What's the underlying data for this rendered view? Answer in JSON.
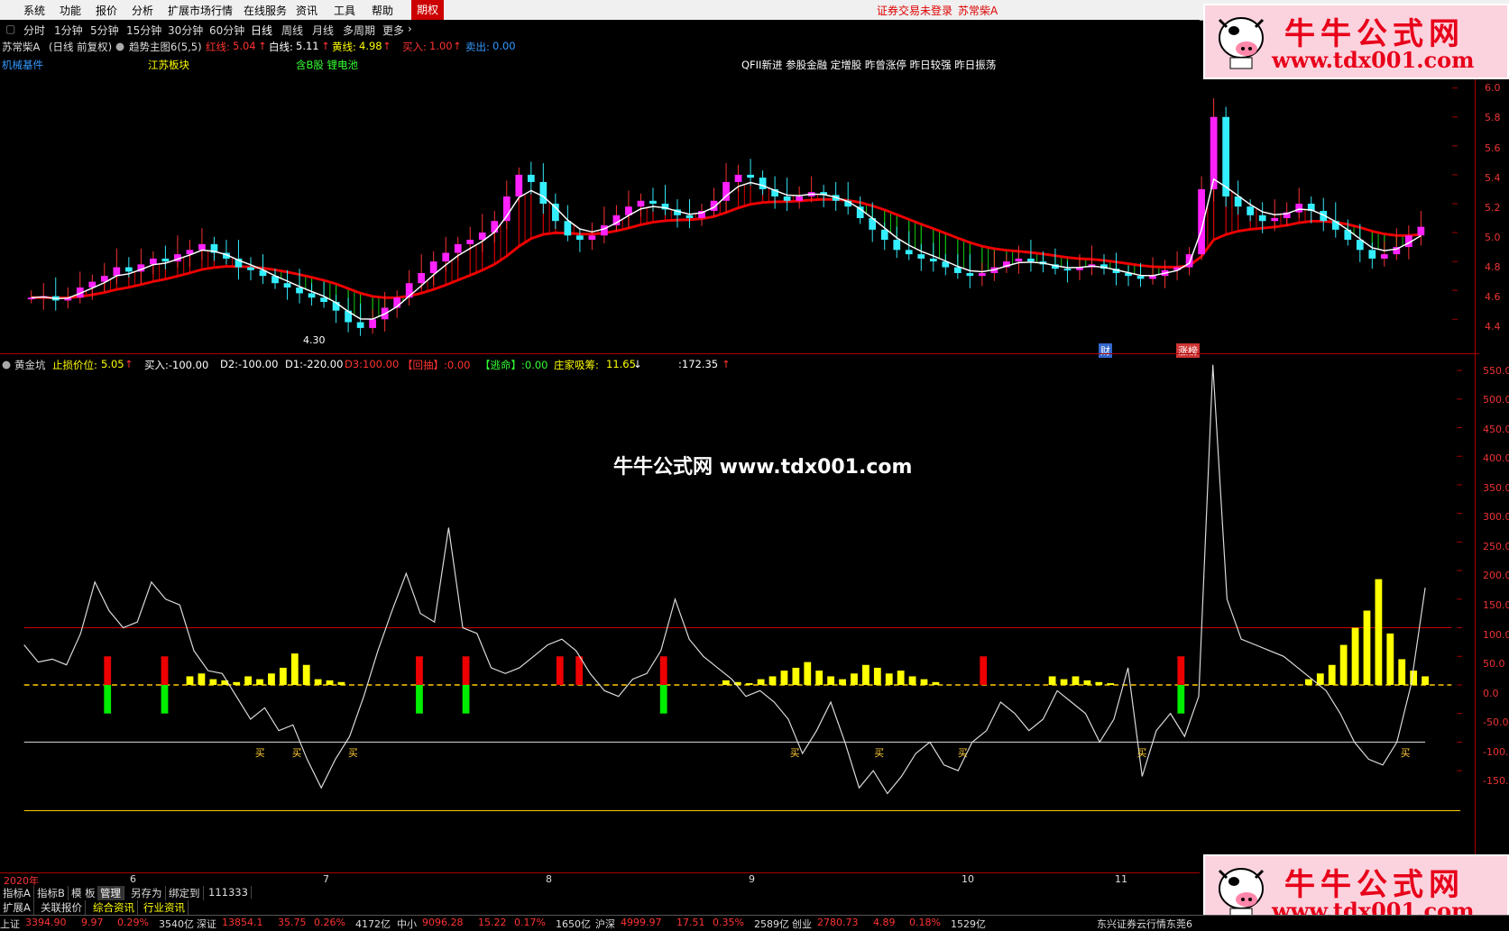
{
  "menu": [
    "系统",
    "功能",
    "报价",
    "分析",
    "扩展市场行情",
    "在线服务",
    "资讯",
    "工具",
    "帮助",
    "期权"
  ],
  "status_notice": "证券交易未登录",
  "status_stock": "苏常柴A",
  "periods": [
    "分时",
    "1分钟",
    "5分钟",
    "15分钟",
    "30分钟",
    "60分钟",
    "日线",
    "周线",
    "月线",
    "多周期",
    "更多"
  ],
  "active_period": "日线",
  "info": {
    "stock": "苏常柴A",
    "mode": "(日线 前复权)",
    "indicator": "趋势主图6(5,5)",
    "red_label": "红线:",
    "red_value": "5.04",
    "white_label": "白线:",
    "white_value": "5.11",
    "yellow_label": "黄线:",
    "yellow_value": "4.98",
    "buy_label": "买入:",
    "buy_value": "1.00",
    "sell_label": "卖出:",
    "sell_value": "0.00"
  },
  "plates": {
    "p1": "机械基件",
    "p2": "江苏板块",
    "p3": "含B股 锂电池",
    "tags": "QFII新进 参股金融 定增股 昨曾涨停 昨日较强 昨日振荡"
  },
  "main_low_label": "4.30",
  "event_tags": [
    "财",
    "涨榜"
  ],
  "main_axis": [
    "6.0",
    "5.8",
    "5.6",
    "5.4",
    "5.2",
    "5.0",
    "4.8",
    "4.6",
    "4.4"
  ],
  "sub_indicator": {
    "name": "黄金坑",
    "stop_label": "止损价位:",
    "stop_value": "5.05",
    "buy": "买入:-100.00",
    "d2": "D2:-100.00",
    "d1": "D1:-220.00",
    "d3": "D3:100.00",
    "pullback": "【回抽】:0.00",
    "escape": "【逃命】:0.00",
    "absorb_label": "庄家吸筹:",
    "absorb_value": "11.65",
    "extra": ":172.35"
  },
  "sub_axis": [
    "550.0",
    "500.0",
    "450.0",
    "400.0",
    "350.0",
    "300.0",
    "250.0",
    "200.0",
    "150.0",
    "100.0",
    "50.0",
    "0.0",
    "-50.0",
    "-100.0",
    "-150.0"
  ],
  "buy_marker": "买",
  "watermark": "牛牛公式网 www.tdx001.com",
  "logo": {
    "title": "牛牛公式网",
    "url": "www.tdx001.com"
  },
  "dates": [
    "2020年",
    "6",
    "7",
    "8",
    "9",
    "10",
    "11"
  ],
  "tabs1": [
    "指标A",
    "指标B",
    "模 板",
    "管理",
    "另存为",
    "绑定到",
    "111333"
  ],
  "tabs2": [
    "扩展A",
    "关联报价",
    "综合资讯",
    "行业资讯"
  ],
  "ticker": [
    {
      "name": "上证",
      "value": "3394.90",
      "chg": "9.97",
      "pct": "0.29%",
      "amt": "3540亿"
    },
    {
      "name": "深证",
      "value": "13854.1",
      "chg": "35.75",
      "pct": "0.26%",
      "amt": "4172亿"
    },
    {
      "name": "中小",
      "value": "9096.28",
      "chg": "15.22",
      "pct": "0.17%",
      "amt": "1650亿"
    },
    {
      "name": "沪深",
      "value": "4999.97",
      "chg": "17.51",
      "pct": "0.35%",
      "amt": "2589亿"
    },
    {
      "name": "创业",
      "value": "2780.73",
      "chg": "4.89",
      "pct": "0.18%",
      "amt": "1529亿"
    }
  ],
  "ticker_news": "东兴证券云行情东莞6",
  "chart_data": {
    "type": "candlestick",
    "closes": [
      4.55,
      4.56,
      4.53,
      4.55,
      4.62,
      4.66,
      4.7,
      4.76,
      4.73,
      4.78,
      4.82,
      4.8,
      4.85,
      4.88,
      4.92,
      4.86,
      4.82,
      4.76,
      4.74,
      4.7,
      4.65,
      4.62,
      4.58,
      4.55,
      4.52,
      4.46,
      4.38,
      4.34,
      4.4,
      4.48,
      4.55,
      4.65,
      4.72,
      4.8,
      4.86,
      4.92,
      4.95,
      5.0,
      5.08,
      5.25,
      5.4,
      5.35,
      5.2,
      5.08,
      4.98,
      4.95,
      4.98,
      5.05,
      5.12,
      5.18,
      5.22,
      5.2,
      5.16,
      5.12,
      5.1,
      5.15,
      5.22,
      5.35,
      5.4,
      5.38,
      5.3,
      5.25,
      5.22,
      5.25,
      5.28,
      5.26,
      5.22,
      5.18,
      5.1,
      5.02,
      4.95,
      4.88,
      4.85,
      4.82,
      4.8,
      4.76,
      4.72,
      4.7,
      4.72,
      4.76,
      4.8,
      4.82,
      4.8,
      4.78,
      4.75,
      4.74,
      4.76,
      4.78,
      4.75,
      4.72,
      4.7,
      4.68,
      4.7,
      4.74,
      4.76,
      4.85,
      5.3,
      5.8,
      5.25,
      5.18,
      5.12,
      5.08,
      5.1,
      5.14,
      5.2,
      5.15,
      5.08,
      5.02,
      4.95,
      4.88,
      4.82,
      4.85,
      4.9,
      4.98,
      5.04
    ],
    "red_line": "slow trend line",
    "sub": {
      "white_line": [
        70,
        40,
        45,
        35,
        90,
        180,
        130,
        100,
        110,
        180,
        150,
        140,
        60,
        25,
        20,
        -20,
        -60,
        -40,
        -80,
        -70,
        -130,
        -180,
        -130,
        -90,
        -20,
        60,
        130,
        195,
        125,
        110,
        275,
        100,
        90,
        30,
        20,
        30,
        50,
        70,
        80,
        60,
        20,
        -10,
        -20,
        10,
        20,
        60,
        150,
        80,
        50,
        30,
        10,
        -20,
        -10,
        -30,
        -60,
        -120,
        -80,
        -30,
        -100,
        -180,
        -150,
        -190,
        -160,
        -120,
        -100,
        -140,
        -150,
        -100,
        -80,
        -30,
        -50,
        -80,
        -60,
        -10,
        -30,
        -50,
        -100,
        -60,
        30,
        -160,
        -80,
        -50,
        -90,
        -20,
        560,
        150,
        80,
        70,
        60,
        50,
        30,
        10,
        -10,
        -50,
        -100,
        -130,
        -140,
        -100,
        0,
        170
      ],
      "bars_yellow": [
        0,
        0,
        0,
        0,
        0,
        0,
        0,
        0,
        0,
        0,
        0,
        0,
        0,
        0,
        15,
        20,
        10,
        8,
        5,
        15,
        10,
        20,
        30,
        55,
        35,
        10,
        8,
        5,
        0,
        0,
        0,
        0,
        0,
        0,
        0,
        0,
        0,
        0,
        0,
        0,
        0,
        0,
        0,
        0,
        0,
        0,
        0,
        0,
        0,
        0,
        0,
        0,
        0,
        0,
        0,
        0,
        0,
        0,
        0,
        0,
        8,
        5,
        3,
        10,
        15,
        25,
        30,
        40,
        25,
        15,
        10,
        20,
        35,
        30,
        20,
        25,
        15,
        10,
        5,
        0,
        0,
        0,
        0,
        0,
        0,
        0,
        0,
        0,
        15,
        10,
        15,
        8,
        5,
        3,
        0,
        0,
        0,
        0,
        0,
        0,
        0,
        0,
        0,
        0,
        0,
        0,
        0,
        0,
        0,
        0,
        10,
        20,
        35,
        70,
        100,
        130,
        185,
        90,
        45,
        25,
        15
      ]
    }
  }
}
